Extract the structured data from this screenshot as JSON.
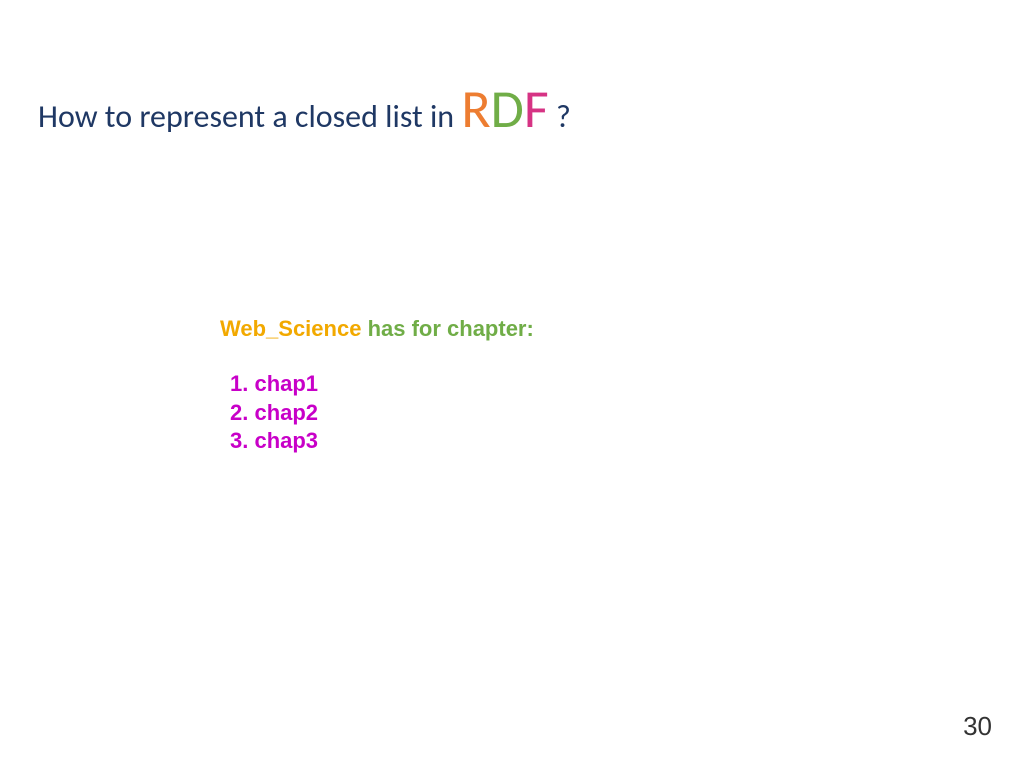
{
  "title": {
    "prefix": "How to represent a closed list in ",
    "r": "R",
    "d": "D",
    "f": "F",
    "suffix": " ?"
  },
  "content": {
    "subject": "Web_Science",
    "predicate": " has for chapter:",
    "items": [
      "1. chap1",
      "2. chap2",
      "3. chap3"
    ]
  },
  "page_number": "30"
}
